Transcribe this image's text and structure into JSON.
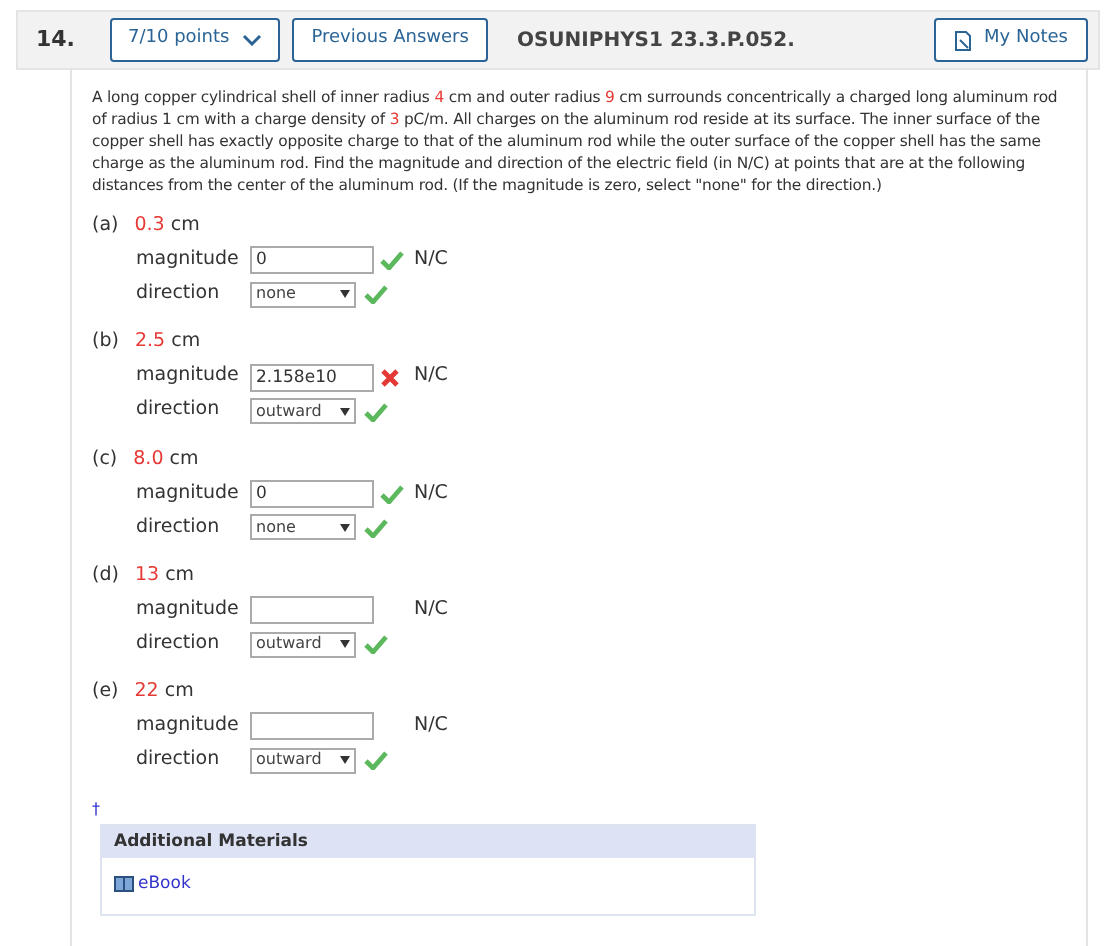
{
  "header": {
    "number": "14.",
    "points": "7/10 points",
    "previous_answers": "Previous Answers",
    "problem_id": "OSUNIPHYS1 23.3.P.052.",
    "my_notes": "My Notes"
  },
  "question": [
    {
      "text": "A long copper cylindrical shell of inner radius ",
      "highlight": false
    },
    {
      "text": "4",
      "highlight": true
    },
    {
      "text": " cm and outer radius ",
      "highlight": false
    },
    {
      "text": "9",
      "highlight": true
    },
    {
      "text": " cm surrounds concentrically a charged long aluminum rod of radius 1 cm with a charge density of ",
      "highlight": false
    },
    {
      "text": "3",
      "highlight": true
    },
    {
      "text": " pC/m. All charges on the aluminum rod reside at its surface. The inner surface of the copper shell has exactly opposite charge to that of the aluminum rod while the outer surface of the copper shell has the same charge as the aluminum rod. Find the magnitude and direction of the electric field (in N/C) at points that are at the following distances from the center of the aluminum rod. (If the magnitude is zero, select \"none\" for the direction.)",
      "highlight": false
    }
  ],
  "parts": [
    {
      "label": "(a)",
      "distance": "0.3",
      "unit": "cm",
      "magnitude_label": "magnitude",
      "magnitude": "0",
      "magnitude_correct": true,
      "units": "N/C",
      "direction_label": "direction",
      "direction": "none",
      "direction_correct": true
    },
    {
      "label": "(b)",
      "distance": "2.5",
      "unit": "cm",
      "magnitude_label": "magnitude",
      "magnitude": "2.158e10",
      "magnitude_correct": false,
      "units": "N/C",
      "direction_label": "direction",
      "direction": "outward",
      "direction_correct": true
    },
    {
      "label": "(c)",
      "distance": "8.0",
      "unit": "cm",
      "magnitude_label": "magnitude",
      "magnitude": "0",
      "magnitude_correct": true,
      "units": "N/C",
      "direction_label": "direction",
      "direction": "none",
      "direction_correct": true
    },
    {
      "label": "(d)",
      "distance": "13",
      "unit": "cm",
      "magnitude_label": "magnitude",
      "units": "N/C",
      "direction_label": "direction",
      "direction": "outward",
      "direction_correct": true
    },
    {
      "label": "(e)",
      "distance": "22",
      "unit": "cm",
      "magnitude_label": "magnitude",
      "units": "N/C",
      "direction_label": "direction",
      "direction": "outward",
      "direction_correct": true
    }
  ],
  "footnote_mark": "†",
  "additional_materials": {
    "title": "Additional Materials",
    "links": [
      "eBook"
    ]
  }
}
